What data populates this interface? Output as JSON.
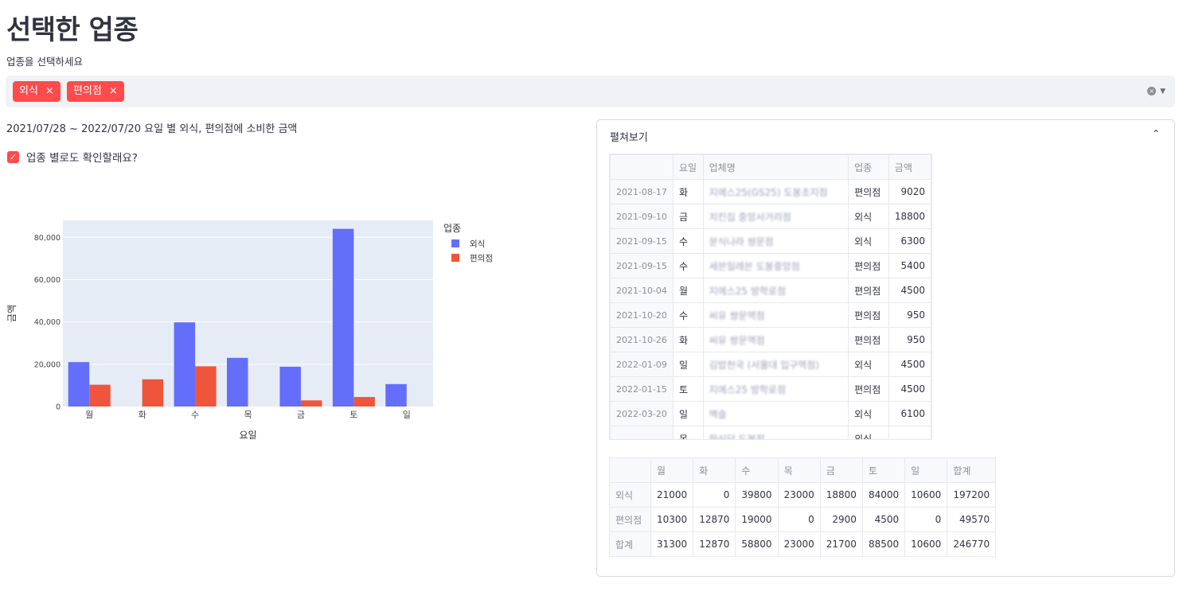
{
  "page": {
    "title": "선택한 업종",
    "multiselect_label": "업종을 선택하세요",
    "subtitle": "2021/07/28 ~ 2022/07/20 요일 별 외식, 편의점에 소비한 금액",
    "checkbox_label": "업종 별로도 확인할래요?",
    "checkbox_mark": "✓",
    "clear_glyph": "×",
    "caret_glyph": "▼",
    "remove_glyph": "×"
  },
  "multiselect": {
    "tags": [
      "외식",
      "편의점"
    ]
  },
  "colors": {
    "accent": "#ff4b4b",
    "series1": "#636efa",
    "series2": "#ef553b",
    "plot_bg": "#e5ecf6"
  },
  "chart_data": {
    "type": "bar",
    "categories": [
      "월",
      "화",
      "수",
      "목",
      "금",
      "토",
      "일"
    ],
    "series": [
      {
        "name": "외식",
        "values": [
          21000,
          0,
          39800,
          23000,
          18800,
          84000,
          10600
        ]
      },
      {
        "name": "편의점",
        "values": [
          10300,
          12870,
          19000,
          0,
          2900,
          4500,
          0
        ]
      }
    ],
    "xlabel": "요일",
    "ylabel": "금액",
    "legend_title": "업종",
    "ylim": [
      0,
      88000
    ],
    "yticks": [
      "0",
      "20,000",
      "40,000",
      "60,000",
      "80,000"
    ],
    "ytick_values": [
      0,
      20000,
      40000,
      60000,
      80000
    ],
    "grid": true,
    "legend_position": "top-right"
  },
  "expander": {
    "label": "펼쳐보기",
    "chevron": "⌃"
  },
  "detail_table": {
    "columns": [
      "",
      "요일",
      "업체명",
      "업종",
      "금액"
    ],
    "rows": [
      {
        "date": "2021-08-17",
        "day": "화",
        "store": "지에스25(GS25) 도봉초지점",
        "type": "편의점",
        "amount": "9020"
      },
      {
        "date": "2021-09-10",
        "day": "금",
        "store": "치킨집 중앙사거리점",
        "type": "외식",
        "amount": "18800"
      },
      {
        "date": "2021-09-15",
        "day": "수",
        "store": "분식나라 쌍문점",
        "type": "외식",
        "amount": "6300"
      },
      {
        "date": "2021-09-15",
        "day": "수",
        "store": "세븐일레븐 도봉중앙점",
        "type": "편의점",
        "amount": "5400"
      },
      {
        "date": "2021-10-04",
        "day": "월",
        "store": "지에스25 방학로점",
        "type": "편의점",
        "amount": "4500"
      },
      {
        "date": "2021-10-20",
        "day": "수",
        "store": "씨유 쌍문역점",
        "type": "편의점",
        "amount": "950"
      },
      {
        "date": "2021-10-26",
        "day": "화",
        "store": "씨유 쌍문역점",
        "type": "편의점",
        "amount": "950"
      },
      {
        "date": "2022-01-09",
        "day": "일",
        "store": "김밥천국 (서울대 입구역점)",
        "type": "외식",
        "amount": "4500"
      },
      {
        "date": "2022-01-15",
        "day": "토",
        "store": "지에스25 방학로점",
        "type": "편의점",
        "amount": "4500"
      },
      {
        "date": "2022-03-20",
        "day": "일",
        "store": "맥슬",
        "type": "외식",
        "amount": "6100"
      },
      {
        "date": "",
        "day": "목",
        "store": "한식당 도봉점",
        "type": "외식",
        "amount": ""
      }
    ]
  },
  "summary_table": {
    "columns": [
      "",
      "월",
      "화",
      "수",
      "목",
      "금",
      "토",
      "일",
      "합계"
    ],
    "rows": [
      {
        "label": "외식",
        "values": [
          "21000",
          "0",
          "39800",
          "23000",
          "18800",
          "84000",
          "10600",
          "197200"
        ]
      },
      {
        "label": "편의점",
        "values": [
          "10300",
          "12870",
          "19000",
          "0",
          "2900",
          "4500",
          "0",
          "49570"
        ]
      },
      {
        "label": "합계",
        "values": [
          "31300",
          "12870",
          "58800",
          "23000",
          "21700",
          "88500",
          "10600",
          "246770"
        ]
      }
    ]
  }
}
